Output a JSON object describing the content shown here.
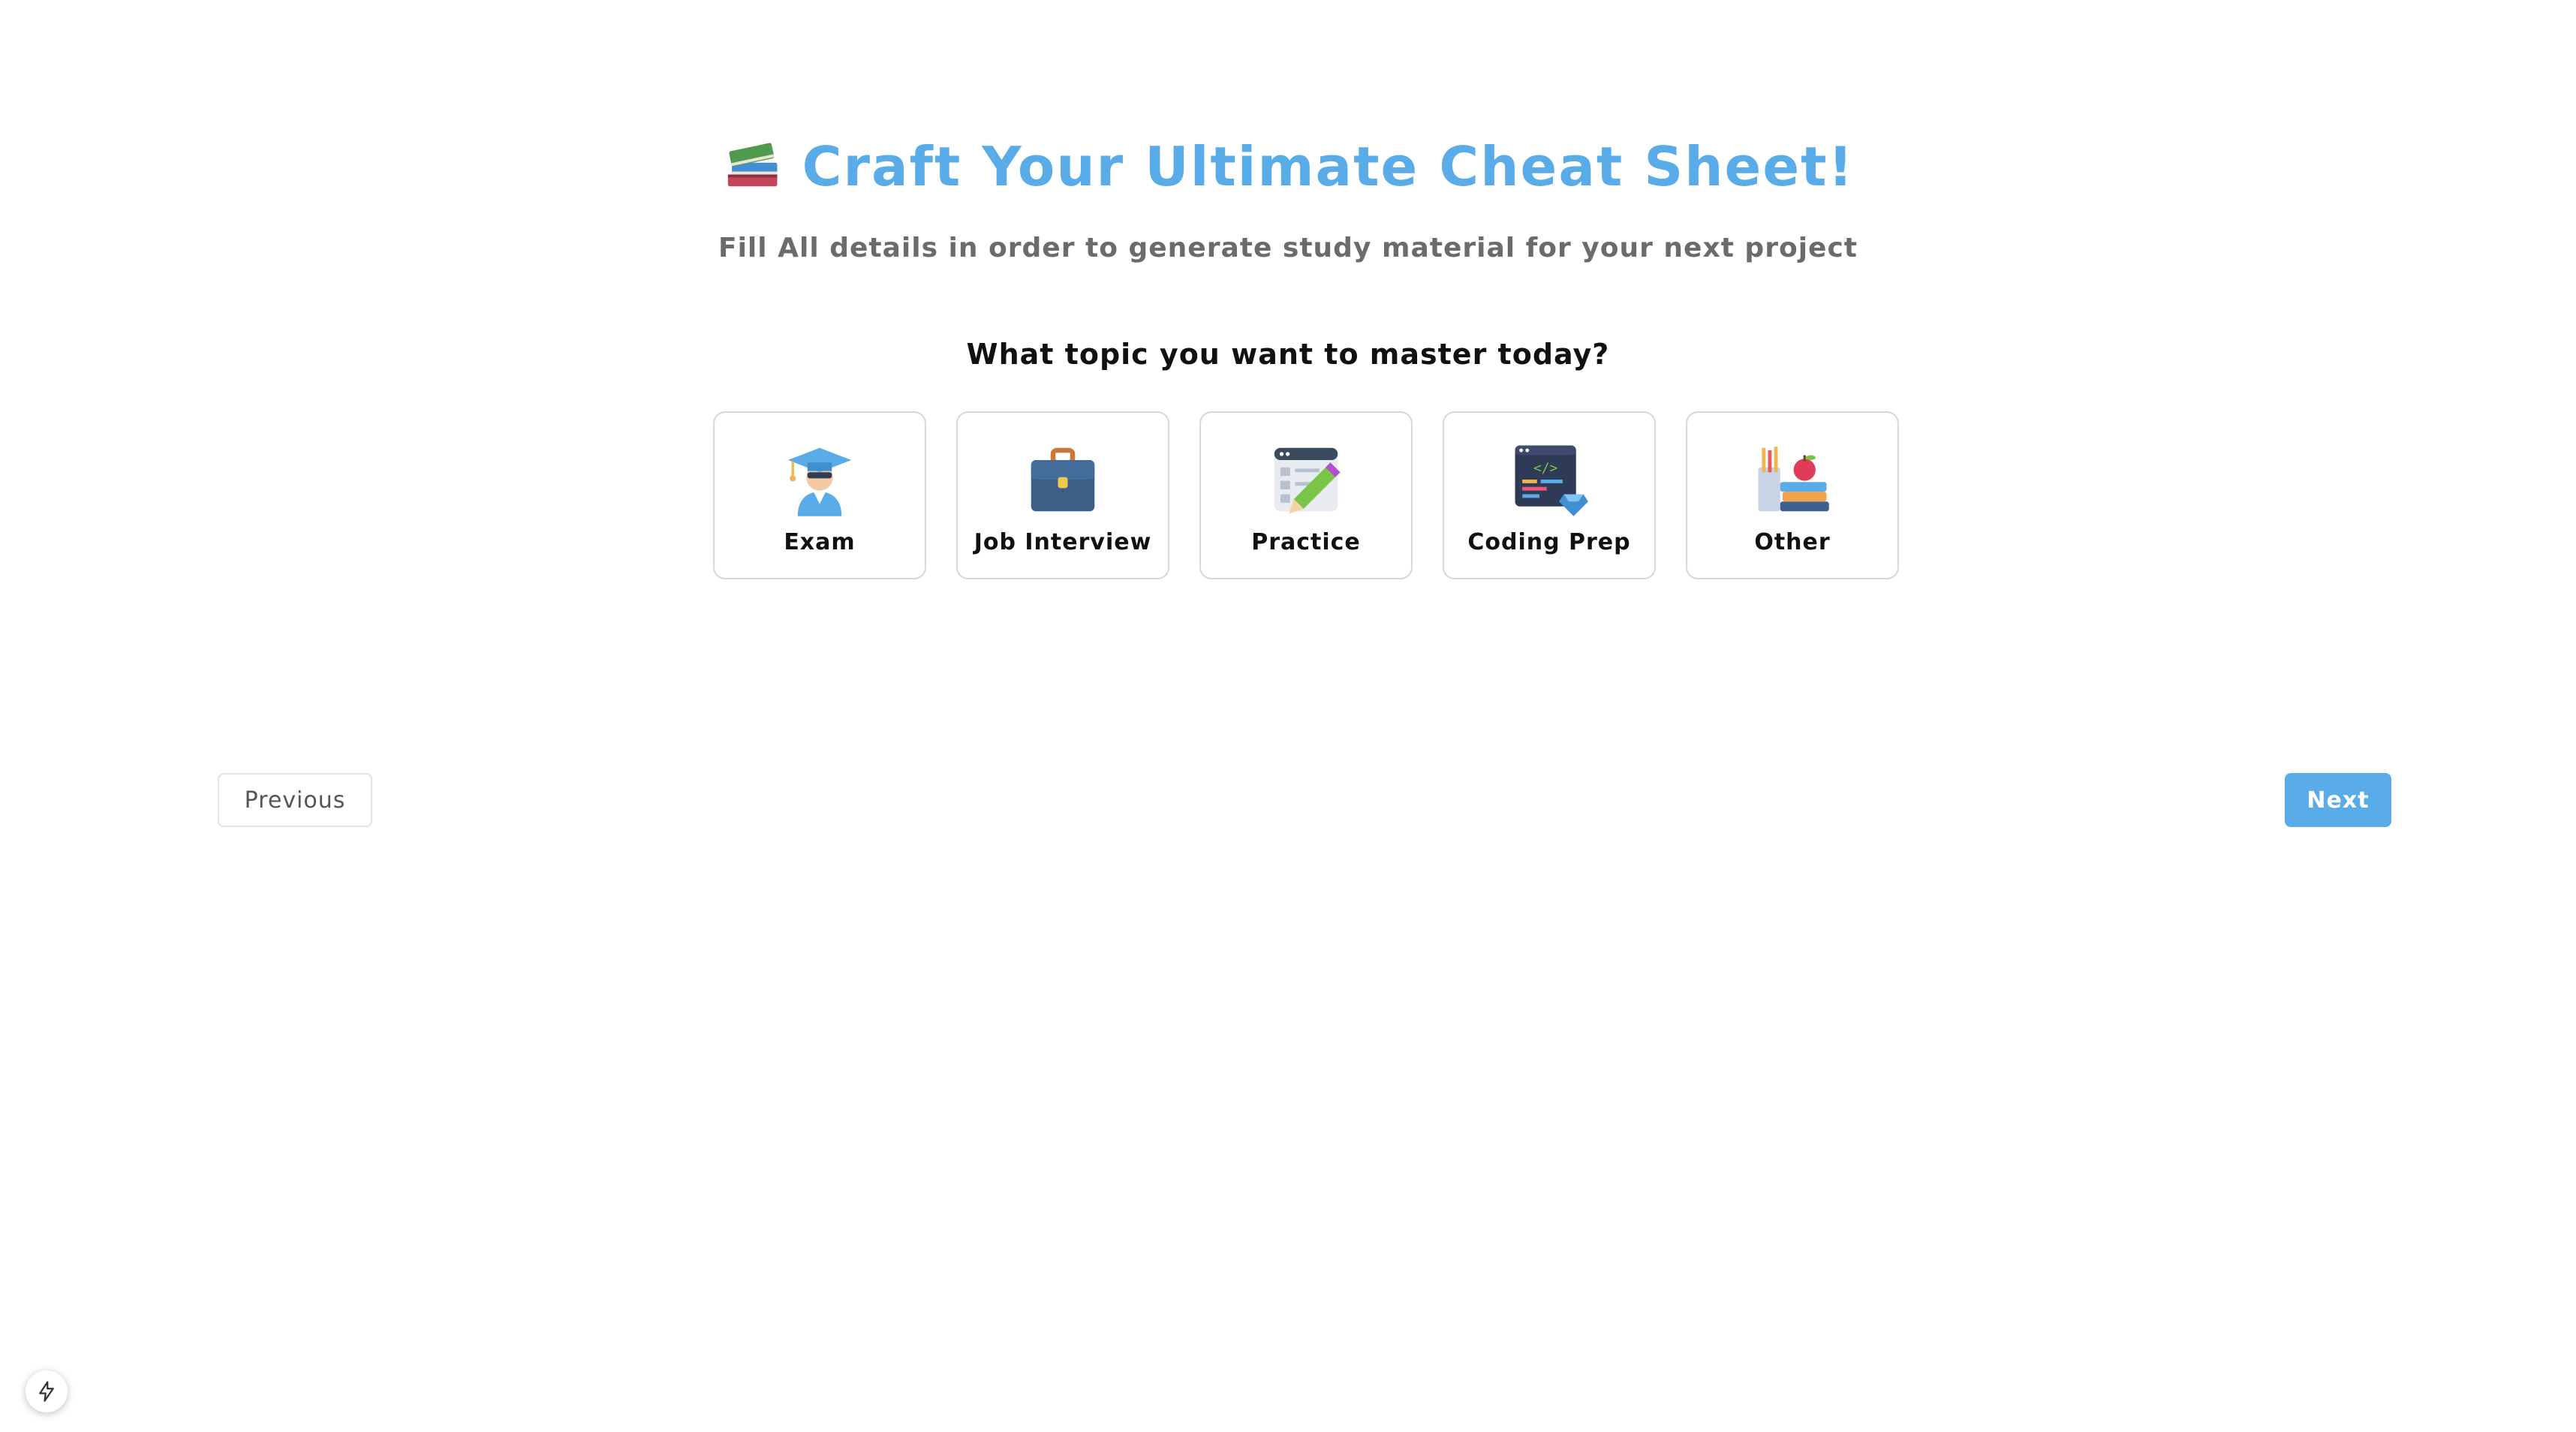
{
  "header": {
    "title": "Craft Your Ultimate Cheat Sheet!",
    "title_icon": "books-icon",
    "subtitle": "Fill All details in order to generate study material for your next project"
  },
  "question": "What topic you want to master today?",
  "options": [
    {
      "label": "Exam",
      "icon": "graduate-icon"
    },
    {
      "label": "Job Interview",
      "icon": "briefcase-icon"
    },
    {
      "label": "Practice",
      "icon": "pencil-document-icon"
    },
    {
      "label": "Coding Prep",
      "icon": "code-window-icon"
    },
    {
      "label": "Other",
      "icon": "books-apple-icon"
    }
  ],
  "nav": {
    "previous_label": "Previous",
    "next_label": "Next"
  },
  "colors": {
    "accent": "#5aace8",
    "text_dark": "#111111",
    "text_muted": "#6b6b6b",
    "border": "#d8d8d8"
  },
  "dev_badge_icon": "lightning-icon"
}
